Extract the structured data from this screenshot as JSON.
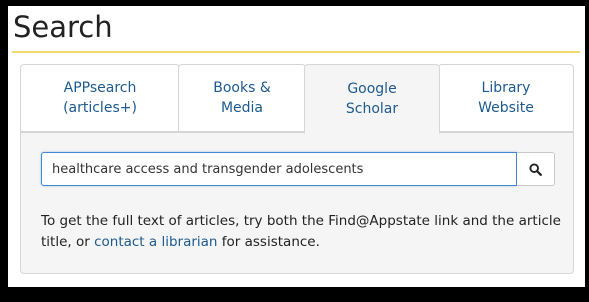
{
  "header": {
    "title": "Search"
  },
  "tabs": [
    {
      "line1": "APPsearch",
      "line2": "(articles+)",
      "active": false
    },
    {
      "line1": "Books &",
      "line2": "Media",
      "active": false
    },
    {
      "line1": "Google",
      "line2": "Scholar",
      "active": true
    },
    {
      "line1": "Library",
      "line2": "Website",
      "active": false
    }
  ],
  "search": {
    "value": "healthcare access and transgender adolescents",
    "button_icon": "search-icon"
  },
  "help": {
    "text_before": "To get the full text of articles, try both the Find@Appstate link and the article title, or ",
    "link_text": "contact a librarian",
    "text_after": " for assistance."
  },
  "colors": {
    "link": "#1d5a8e",
    "accent_rule": "#f3d96b",
    "input_focus_border": "#3f8ad0",
    "tab_panel_bg": "#f5f5f5"
  }
}
